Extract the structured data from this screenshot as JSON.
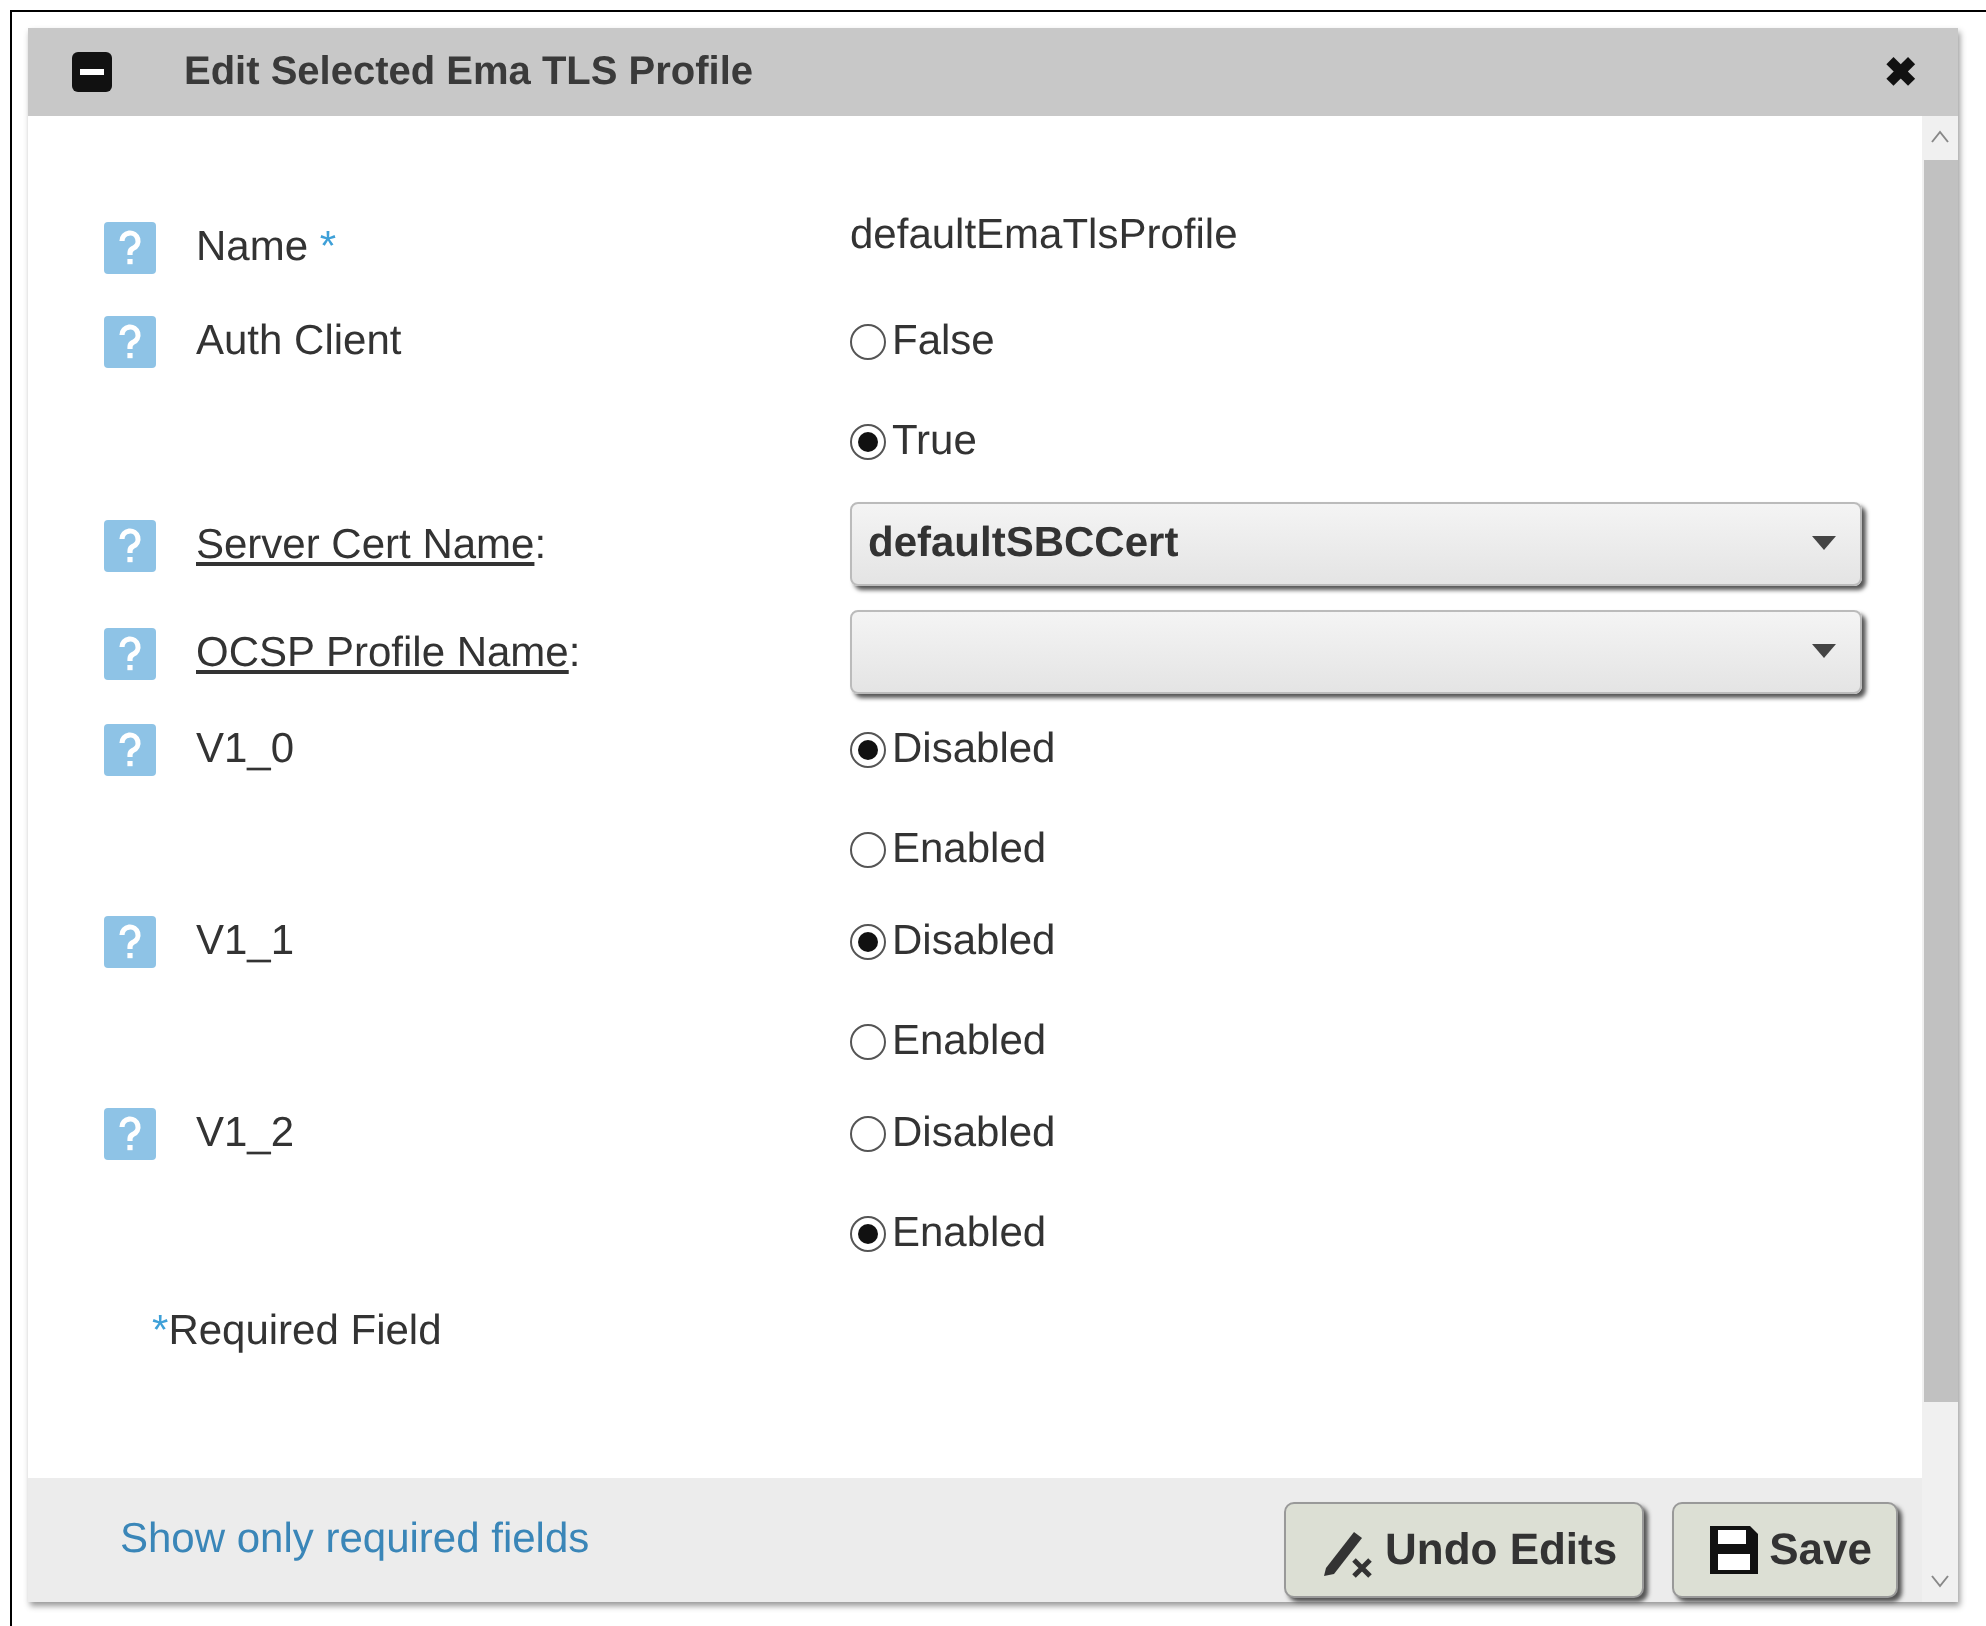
{
  "dialog": {
    "title": "Edit Selected Ema TLS Profile",
    "close_label": "✖"
  },
  "fields": [
    {
      "kind": "text",
      "label": "Name",
      "required_mark": "*",
      "value": "defaultEmaTlsProfile"
    },
    {
      "kind": "radio",
      "label": "Auth Client",
      "options": [
        {
          "label": "False",
          "selected": false
        },
        {
          "label": "True",
          "selected": true
        }
      ]
    },
    {
      "kind": "select",
      "label": "Server Cert Name",
      "suffix": ":",
      "value": "defaultSBCCert"
    },
    {
      "kind": "select",
      "label": "OCSP Profile Name",
      "suffix": ":"
    },
    {
      "kind": "radio",
      "label": "V1_0",
      "options": [
        {
          "label": "Disabled",
          "selected": true
        },
        {
          "label": "Enabled",
          "selected": false
        }
      ]
    },
    {
      "kind": "radio",
      "label": "V1_1",
      "options": [
        {
          "label": "Disabled",
          "selected": true
        },
        {
          "label": "Enabled",
          "selected": false
        }
      ]
    },
    {
      "kind": "radio",
      "label": "V1_2",
      "options": [
        {
          "label": "Disabled",
          "selected": false
        },
        {
          "label": "Enabled",
          "selected": true
        }
      ]
    }
  ],
  "required_note": {
    "mark": "*",
    "text": "Required Field"
  },
  "footer": {
    "link": "Show only required fields",
    "buttons": [
      {
        "kind": "undo",
        "label": "Undo Edits"
      },
      {
        "kind": "save",
        "label": "Save"
      }
    ]
  }
}
